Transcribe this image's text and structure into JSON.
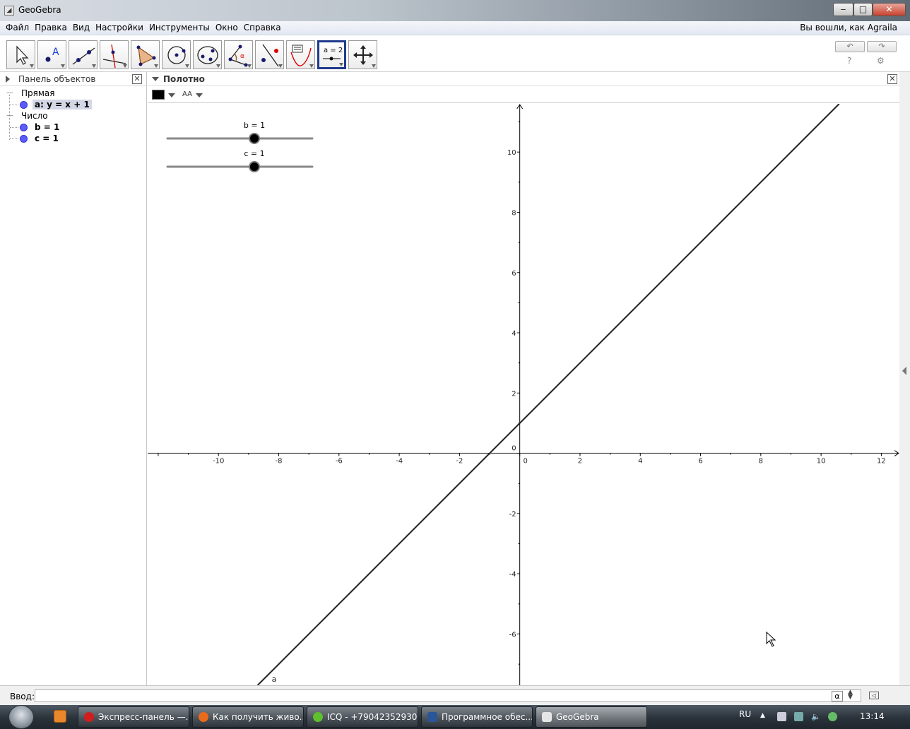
{
  "window": {
    "title": "GeoGebra",
    "minimize": "‒",
    "maximize": "□",
    "close": "✕"
  },
  "menu": {
    "items": [
      "Файл",
      "Правка",
      "Вид",
      "Настройки",
      "Инструменты",
      "Окно",
      "Справка"
    ],
    "login": "Вы вошли, как Agraila"
  },
  "toolbar": {
    "tools": [
      {
        "name": "move-tool-icon"
      },
      {
        "name": "point-tool-icon"
      },
      {
        "name": "line-tool-icon"
      },
      {
        "name": "perpendicular-tool-icon"
      },
      {
        "name": "polygon-tool-icon"
      },
      {
        "name": "circle-tool-icon"
      },
      {
        "name": "conic-tool-icon"
      },
      {
        "name": "angle-tool-icon"
      },
      {
        "name": "reflect-tool-icon"
      },
      {
        "name": "text-tool-icon"
      },
      {
        "name": "slider-tool-icon",
        "label": "a = 2",
        "active": true
      },
      {
        "name": "move-view-tool-icon"
      }
    ],
    "undo": "↶",
    "redo": "↷",
    "help": "?",
    "settings": "⚙"
  },
  "algebra_panel": {
    "title": "Панель объектов",
    "groups": [
      {
        "label": "Прямая",
        "objects": [
          {
            "text": "a: y = x + 1",
            "selected": true
          }
        ]
      },
      {
        "label": "Число",
        "objects": [
          {
            "text": "b = 1"
          },
          {
            "text": "c = 1"
          }
        ]
      }
    ]
  },
  "graphics_panel": {
    "title": "Полотно",
    "font_button": "AA",
    "sliders": [
      {
        "label": "b = 1",
        "value": 1,
        "min": -5,
        "max": 5
      },
      {
        "label": "c = 1",
        "value": 1,
        "min": -5,
        "max": 5
      }
    ],
    "line_label": "a"
  },
  "chart_data": {
    "type": "line",
    "title": "",
    "xlabel": "",
    "ylabel": "",
    "xlim": [
      -12.35,
      12.6
    ],
    "ylim": [
      -7.7,
      11.6
    ],
    "x_ticks": [
      -10,
      -8,
      -6,
      -4,
      -2,
      0,
      2,
      4,
      6,
      8,
      10,
      12
    ],
    "y_ticks": [
      -6,
      -4,
      -2,
      0,
      2,
      4,
      6,
      8,
      10
    ],
    "series": [
      {
        "name": "a",
        "equation": "y = x + 1",
        "slope": 1,
        "intercept": 1
      }
    ],
    "grid": false
  },
  "input_bar": {
    "label": "Ввод:",
    "alpha": "α",
    "value": ""
  },
  "taskbar": {
    "tasks": [
      {
        "label": "Экспресс-панель —...",
        "color": "#d21d1d"
      },
      {
        "label": "Как получить живо...",
        "color": "#e86a1a"
      },
      {
        "label": "ICQ - +79042352930",
        "color": "#5fbf2c"
      },
      {
        "label": "Программное обес...",
        "color": "#2a5699"
      },
      {
        "label": "GeoGebra",
        "color": "#e6e6e6",
        "active": true
      }
    ],
    "lang": "RU",
    "time": "13:14"
  }
}
